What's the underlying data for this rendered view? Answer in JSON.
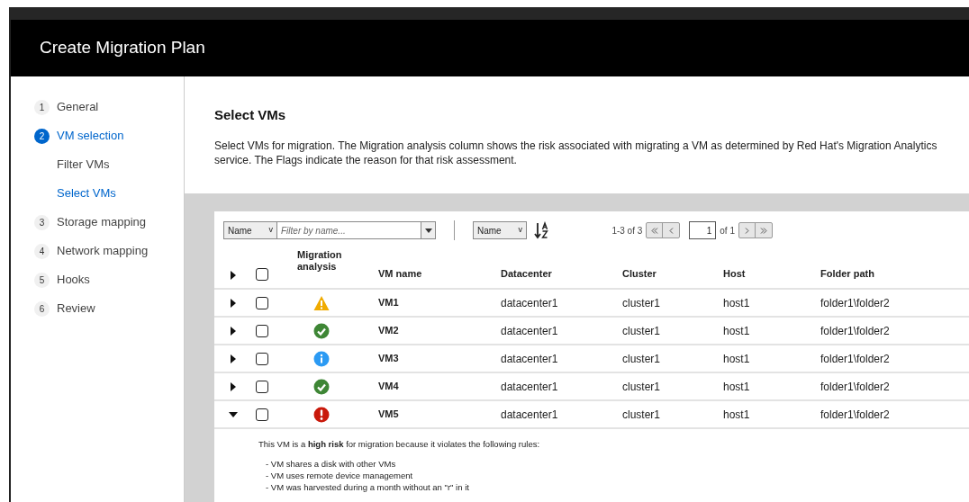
{
  "dialog": {
    "title": "Create Migration Plan"
  },
  "steps": [
    {
      "number": "1",
      "label": "General",
      "selected": false
    },
    {
      "number": "2",
      "label": "VM selection",
      "selected": true,
      "children": [
        {
          "label": "Filter VMs",
          "selected": false
        },
        {
          "label": "Select VMs",
          "selected": true
        }
      ]
    },
    {
      "number": "3",
      "label": "Storage mapping",
      "selected": false
    },
    {
      "number": "4",
      "label": "Network mapping",
      "selected": false
    },
    {
      "number": "5",
      "label": "Hooks",
      "selected": false
    },
    {
      "number": "6",
      "label": "Review",
      "selected": false
    }
  ],
  "section": {
    "title": "Select VMs",
    "description": "Select VMs for migration. The Migration analysis column shows the risk associated with migrating a VM as determined by Red Hat's Migration Analytics service. The Flags indicate the reason for that risk assessment."
  },
  "toolbar": {
    "filter_chevron": "v",
    "sort_chevron": "v",
    "filter_attribute": "Name",
    "filter_placeholder": "Filter by name...",
    "sort_attribute": "Name",
    "range": "1-3 of 3",
    "page": "1",
    "page_total": "of 1"
  },
  "table": {
    "columns": [
      "Migration analysis",
      "VM name",
      "Datacenter",
      "Cluster",
      "Host",
      "Folder path"
    ],
    "all_checked": false,
    "rows": [
      {
        "kind": "warning",
        "vm": "VM1",
        "datacenter": "datacenter1",
        "cluster": "cluster1",
        "host": "host1",
        "folder": "folder1\\folder2",
        "expanded": false,
        "checked": false
      },
      {
        "kind": "ok",
        "vm": "VM2",
        "datacenter": "datacenter1",
        "cluster": "cluster1",
        "host": "host1",
        "folder": "folder1\\folder2",
        "expanded": false,
        "checked": false
      },
      {
        "kind": "info",
        "vm": "VM3",
        "datacenter": "datacenter1",
        "cluster": "cluster1",
        "host": "host1",
        "folder": "folder1\\folder2",
        "expanded": false,
        "checked": false
      },
      {
        "kind": "ok",
        "vm": "VM4",
        "datacenter": "datacenter1",
        "cluster": "cluster1",
        "host": "host1",
        "folder": "folder1\\folder2",
        "expanded": false,
        "checked": false
      },
      {
        "kind": "error",
        "vm": "VM5",
        "datacenter": "datacenter1",
        "cluster": "cluster1",
        "host": "host1",
        "folder": "folder1\\folder2",
        "expanded": true,
        "checked": false,
        "detail": {
          "summary": "This VM is a **high risk** for migration because it violates the following rules:",
          "rules": [
            "- VM shares a disk with other VMs",
            "- VM uses remote device management",
            "- VM was harvested during a month without an \"r\" in it"
          ]
        }
      }
    ]
  }
}
